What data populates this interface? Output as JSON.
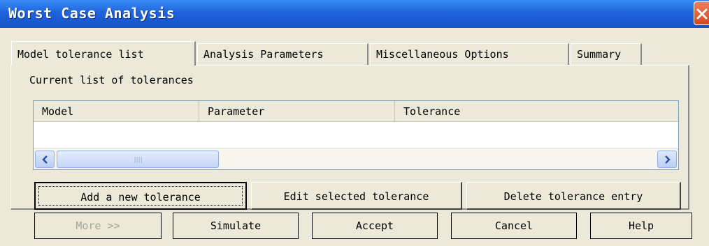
{
  "window": {
    "title": "Worst Case Analysis"
  },
  "tabs": [
    {
      "label": "Model tolerance list",
      "active": true
    },
    {
      "label": "Analysis Parameters",
      "active": false
    },
    {
      "label": "Miscellaneous Options",
      "active": false
    },
    {
      "label": "Summary",
      "active": false
    }
  ],
  "list": {
    "label": "Current list of tolerances",
    "columns": [
      "Model",
      "Parameter",
      "Tolerance"
    ],
    "rows": []
  },
  "list_buttons": {
    "add": "Add a new tolerance",
    "edit": "Edit selected tolerance",
    "delete": "Delete tolerance entry"
  },
  "dialog_buttons": {
    "more": "More >>",
    "simulate": "Simulate",
    "accept": "Accept",
    "cancel": "Cancel",
    "help": "Help"
  },
  "icons": [
    "close-icon",
    "scroll-left-icon",
    "scroll-right-icon"
  ],
  "colors": {
    "titlebar": "#1e63dc",
    "close": "#e0522b",
    "face": "#ece9d8"
  }
}
